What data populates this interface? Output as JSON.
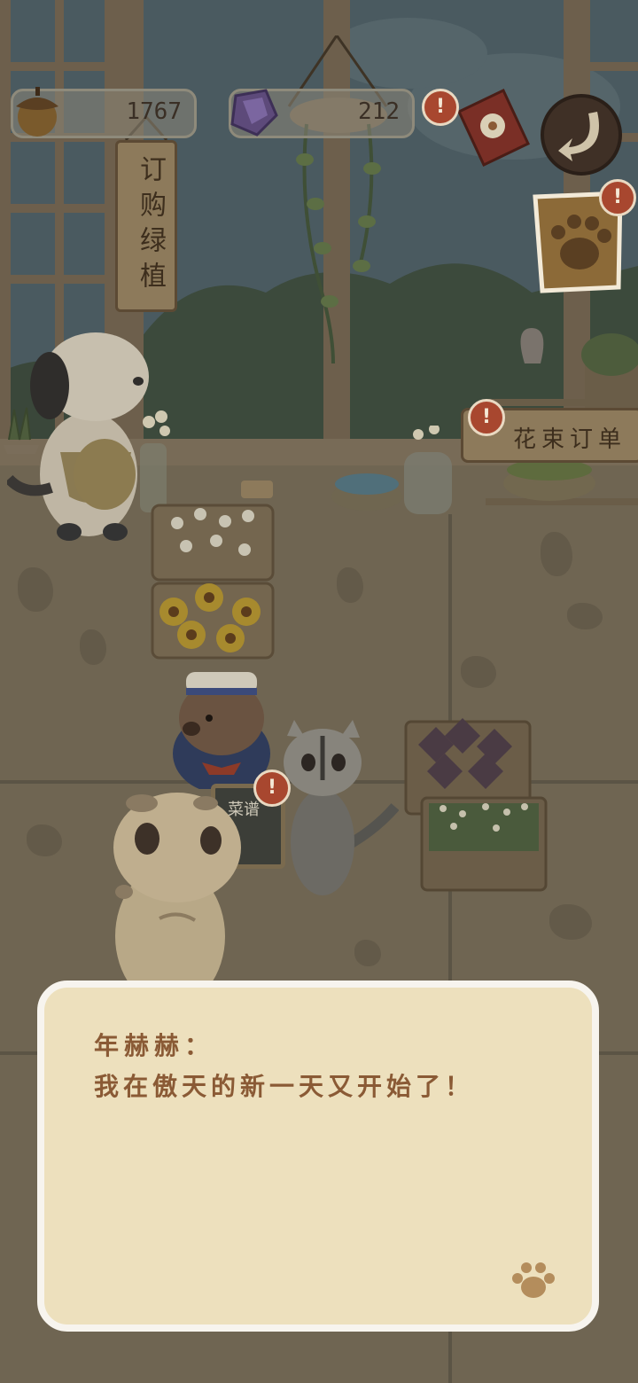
{
  "hud": {
    "acorn": {
      "icon": "acorn-icon",
      "value": "1767"
    },
    "gem": {
      "icon": "purple-gem-icon",
      "value": "212"
    },
    "journal_icon": "flower-book-icon",
    "back_icon": "return-arrow-icon",
    "paw_note_icon": "paw-note-icon"
  },
  "signs": {
    "order_plants": "订购绿植",
    "flower_orders": "花束订单",
    "menu_board": "菜谱"
  },
  "dialog": {
    "speaker": "年赫赫：",
    "text": "我在傲天的新一天又开始了！",
    "next_icon": "paw-icon"
  },
  "colors": {
    "alert": "#a8472f",
    "dialog_bg": "#ede0bd",
    "dialog_border": "#f7f4ee",
    "dialog_text": "#8a5a35"
  }
}
